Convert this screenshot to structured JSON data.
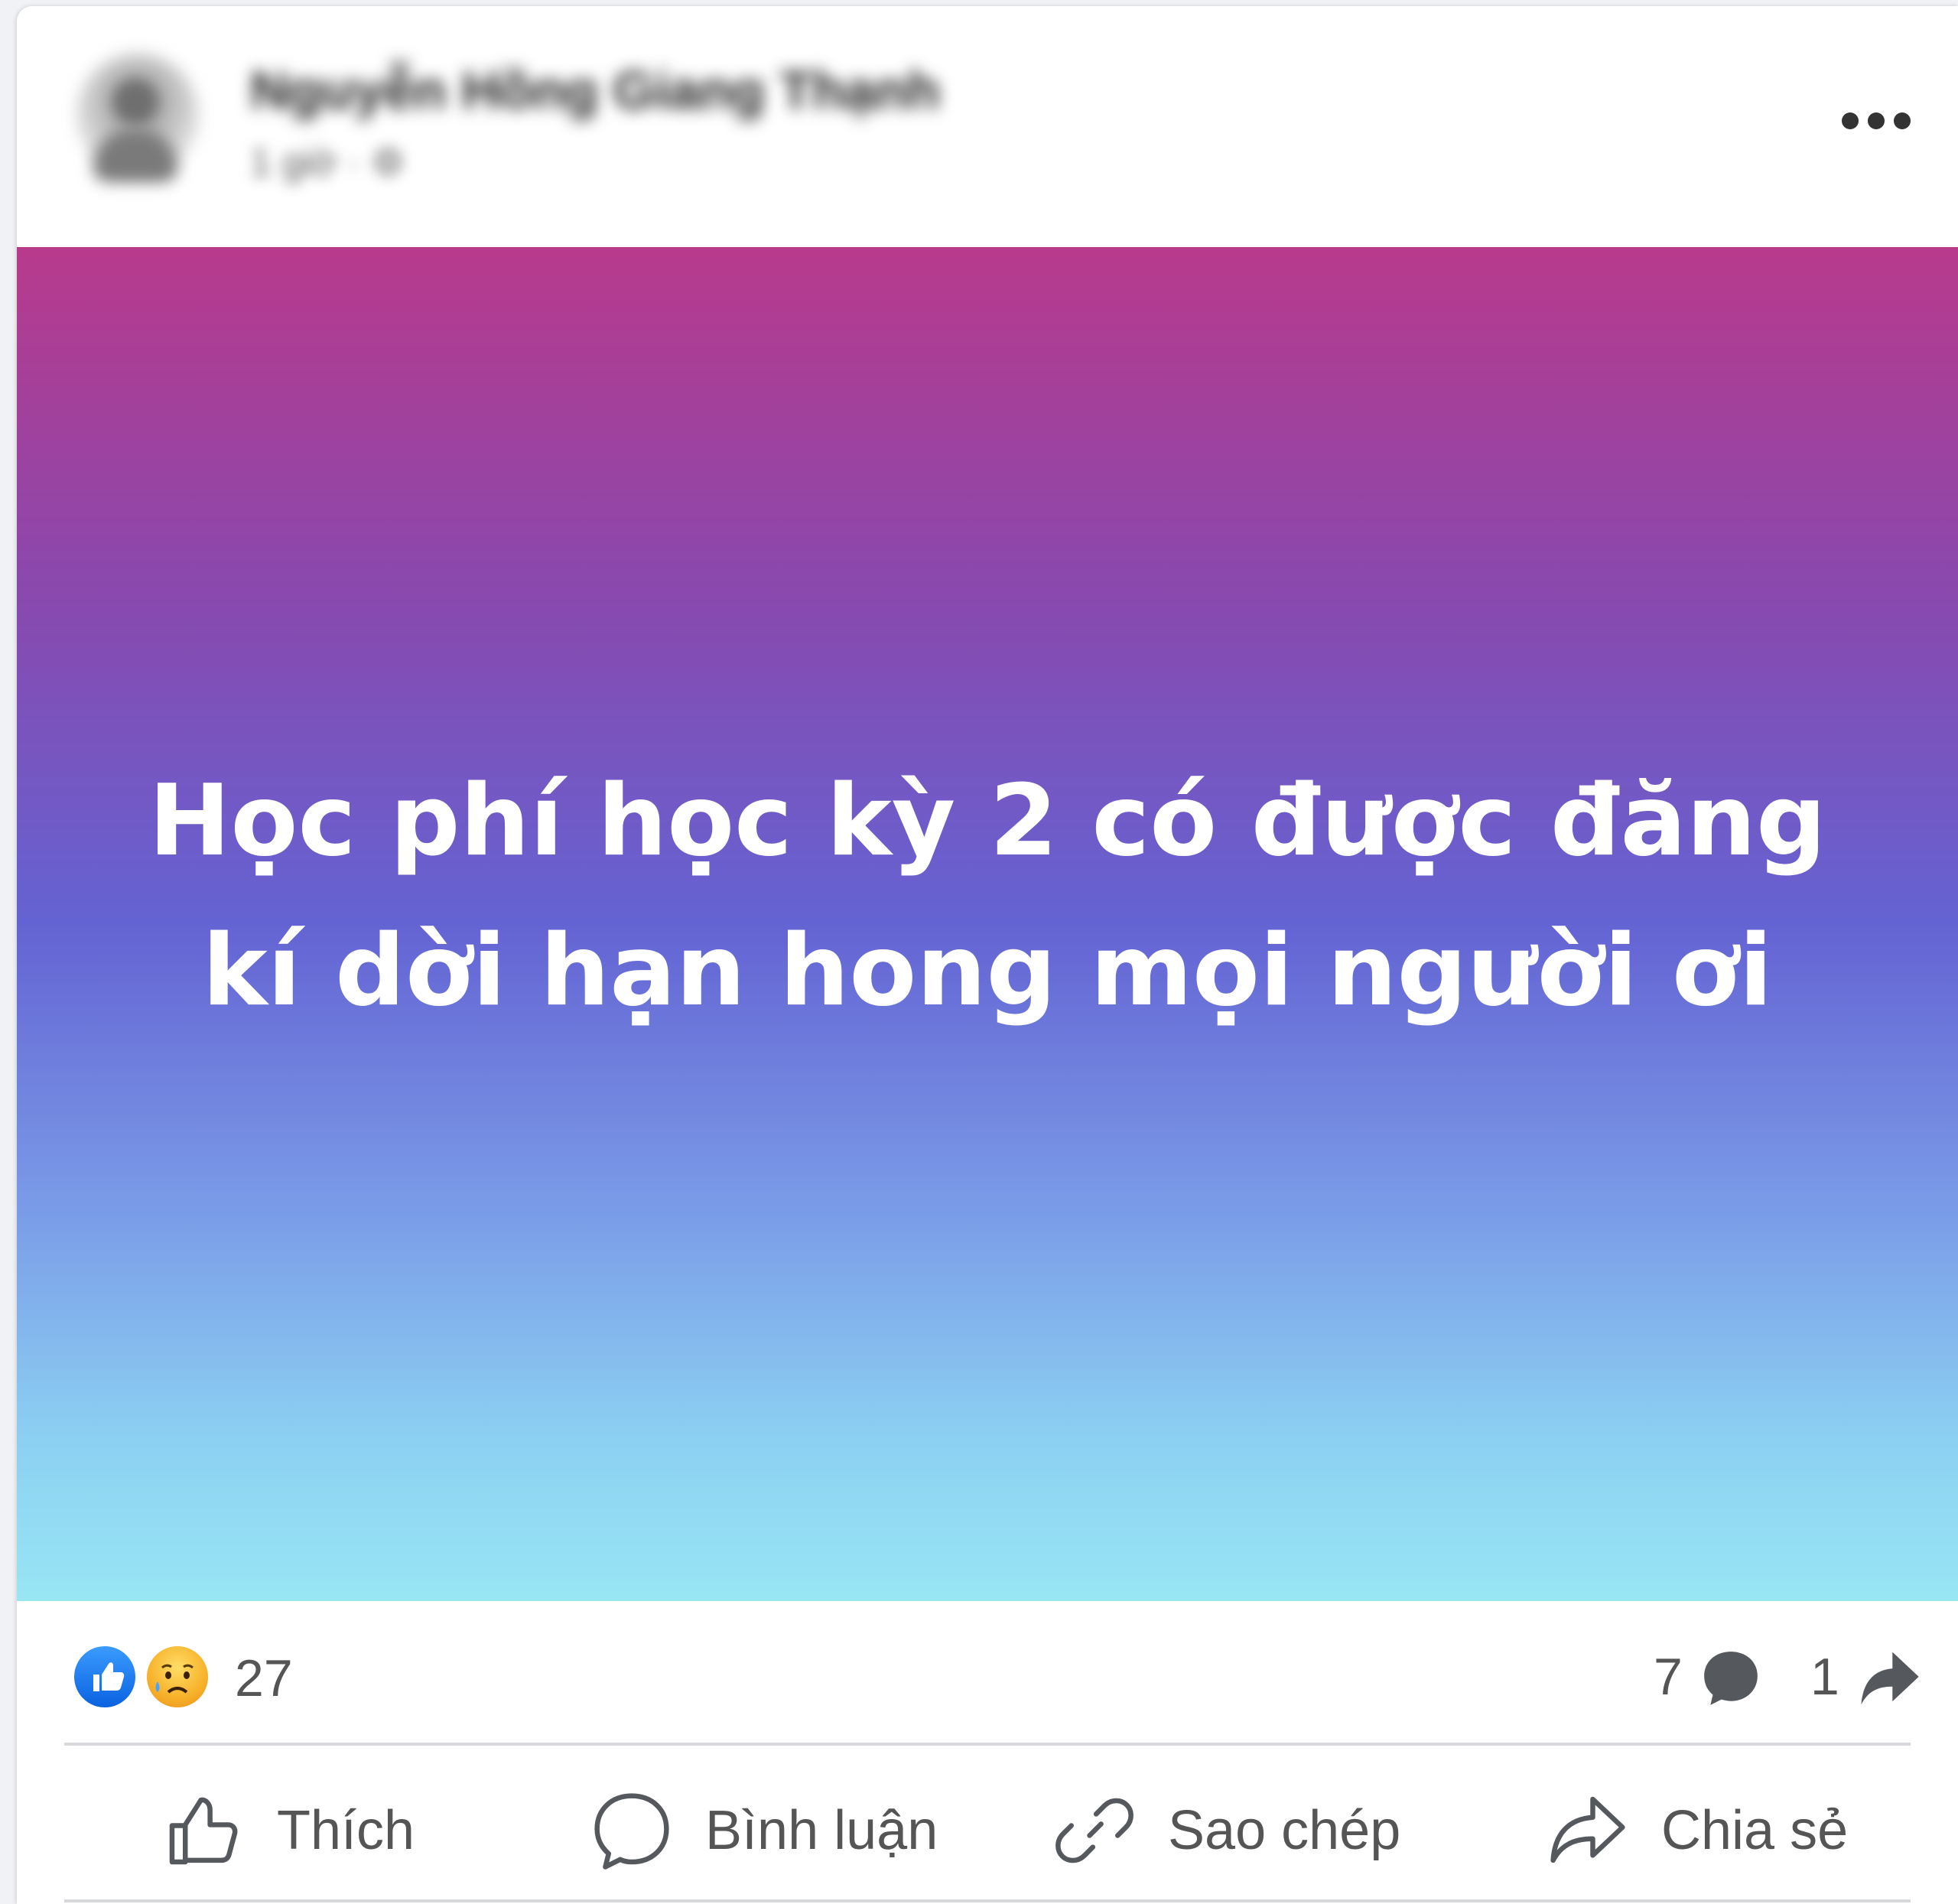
{
  "post": {
    "author_name": "Nguyễn Hồng Giang Thạnh",
    "meta": "1 giờ · ⚙",
    "text_line1": "Học phí học kỳ 2 có được đăng",
    "text_line2": "kí dời hạn hong mọi người ơi",
    "background_gradient": [
      "#b83a8c",
      "#8a48ad",
      "#6463d3",
      "#7b9ee8",
      "#8cd0f2",
      "#98e6f4"
    ]
  },
  "stats": {
    "reactions": [
      "like-icon",
      "sad-icon"
    ],
    "reaction_count": "27",
    "comment_count": "7",
    "share_count": "1"
  },
  "actions": {
    "like_label": "Thích",
    "comment_label": "Bình luận",
    "copy_label": "Sao chép",
    "share_label": "Chia sẻ"
  },
  "colors": {
    "like_blue": "#1877f2",
    "text_gray": "#555555",
    "divider": "#d6d8dc"
  }
}
